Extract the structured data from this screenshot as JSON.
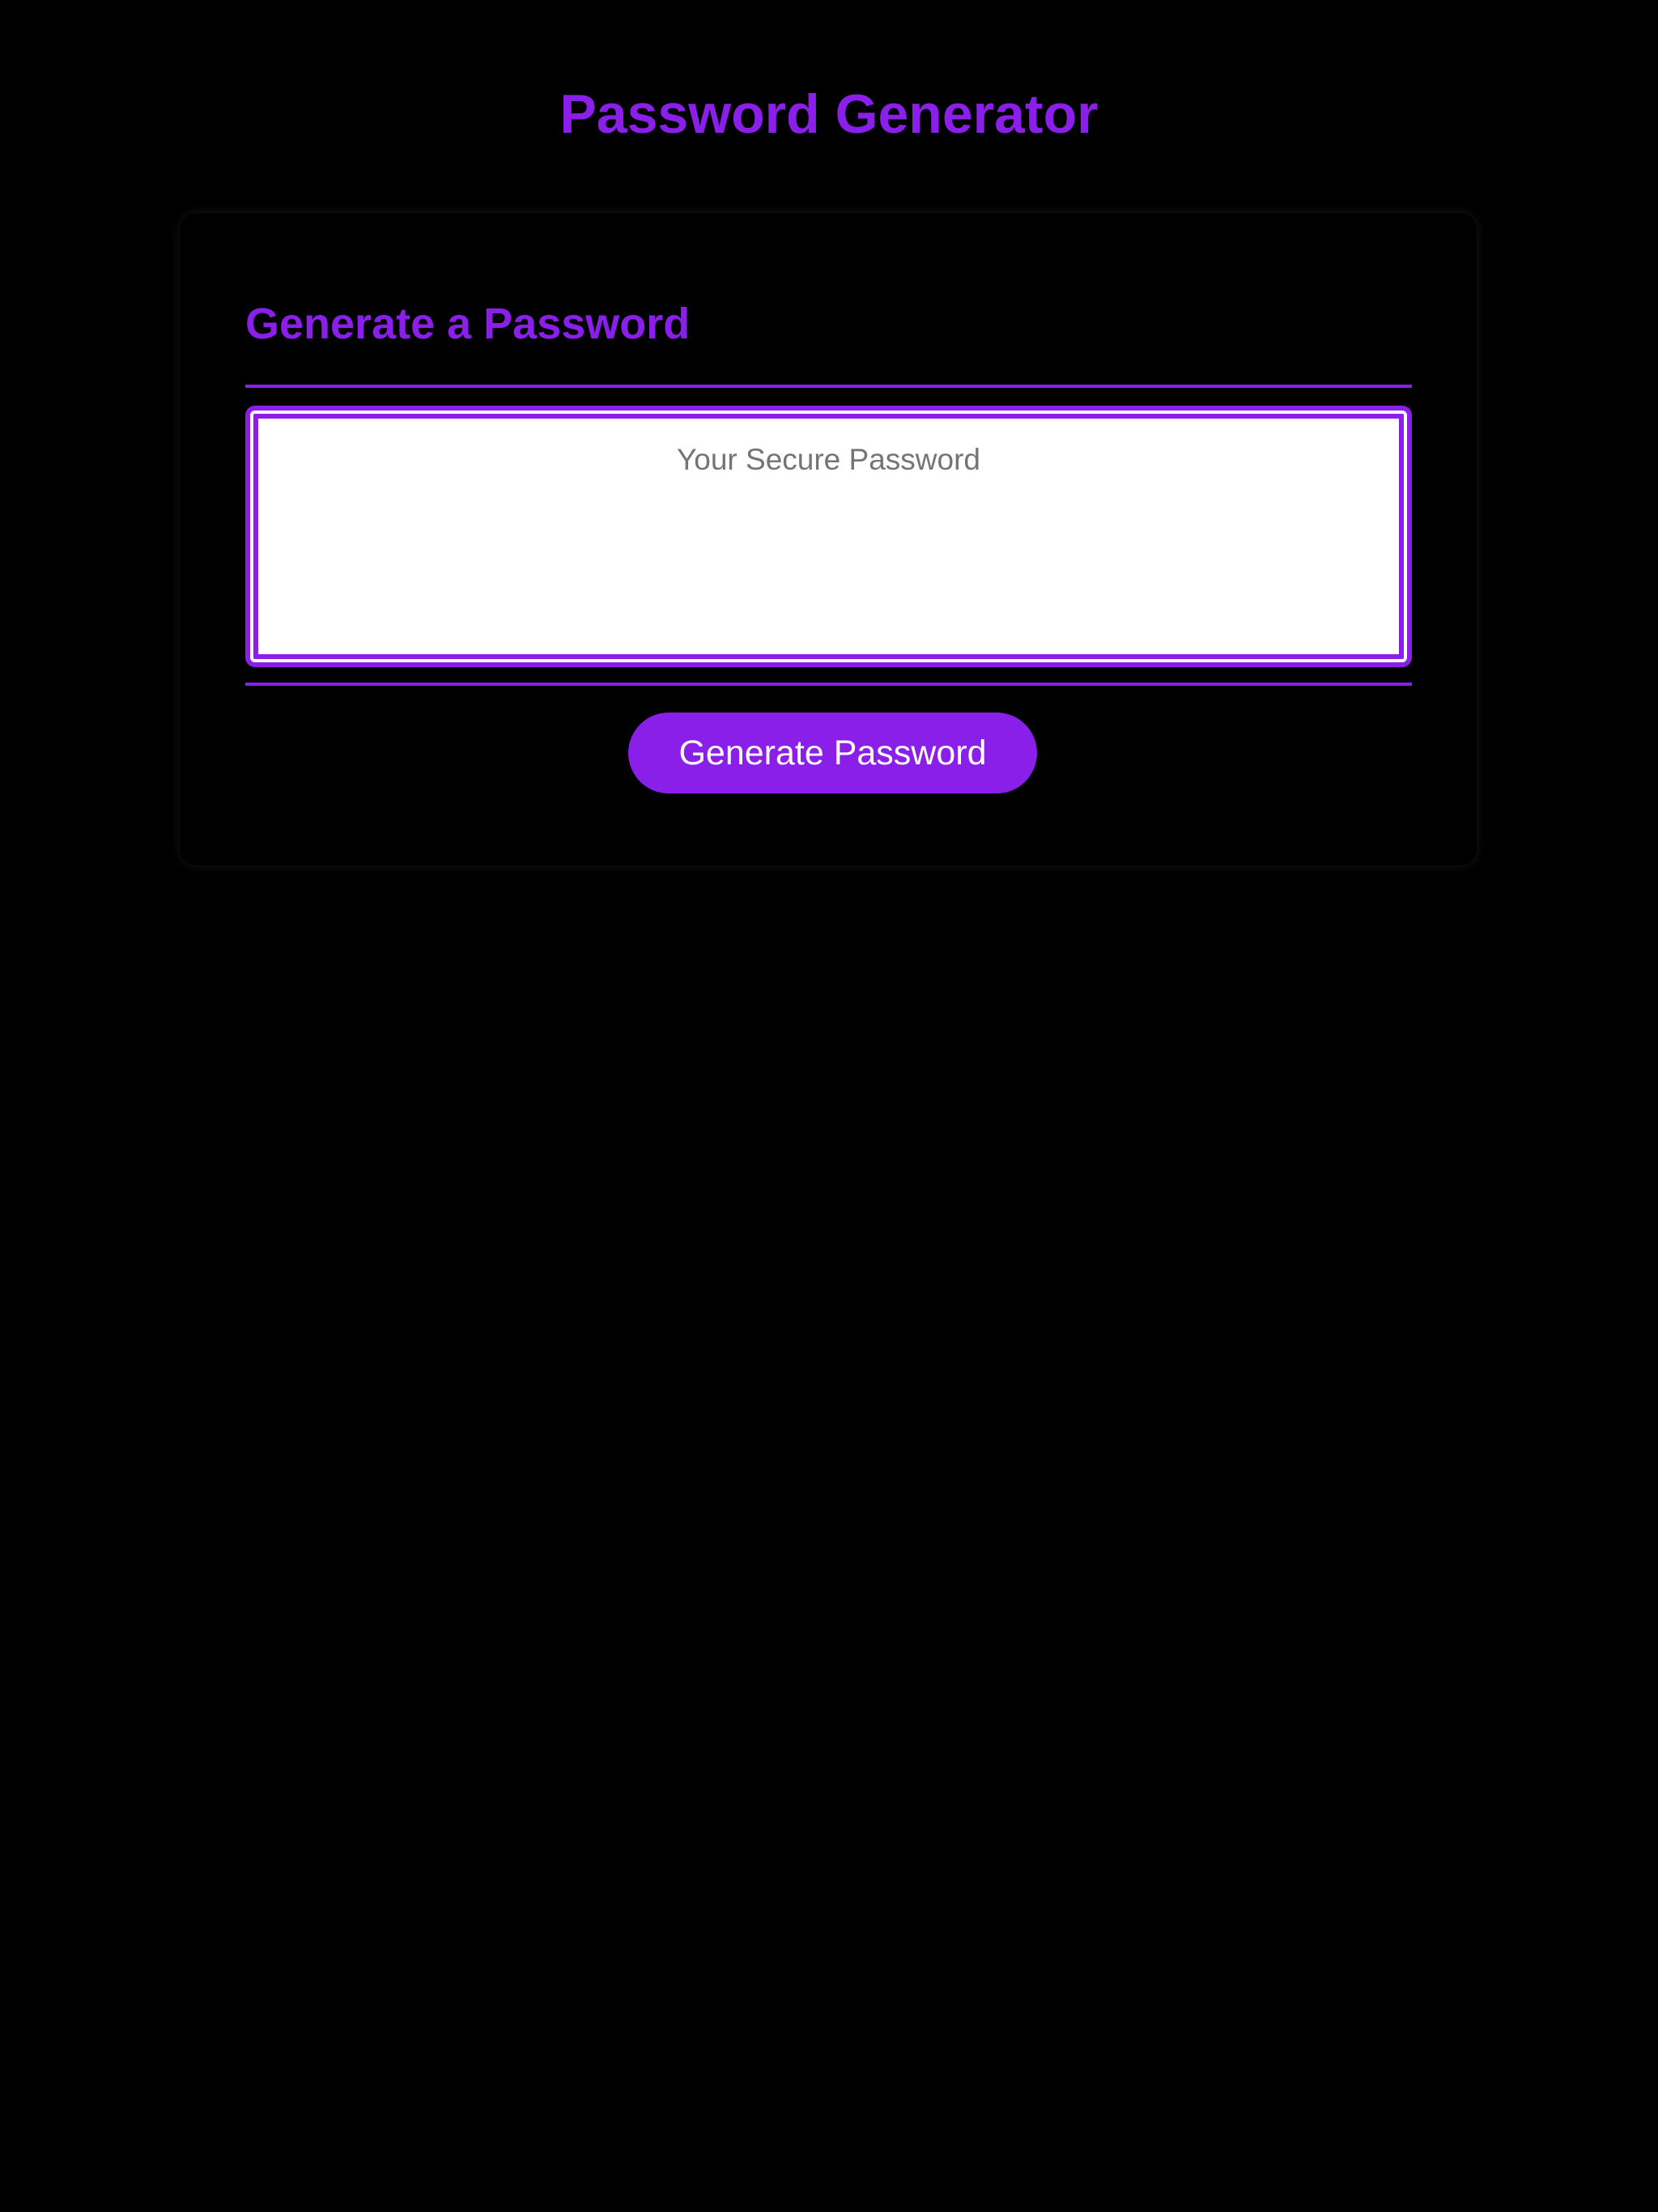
{
  "header": {
    "title": "Password Generator"
  },
  "card": {
    "title": "Generate a Password",
    "password": {
      "placeholder": "Your Secure Password",
      "value": ""
    },
    "generate_button_label": "Generate Password"
  },
  "colors": {
    "accent": "#8a1fea",
    "background": "#000000",
    "field_background": "#ffffff",
    "placeholder_text": "#757575",
    "button_text": "#ffffff"
  }
}
